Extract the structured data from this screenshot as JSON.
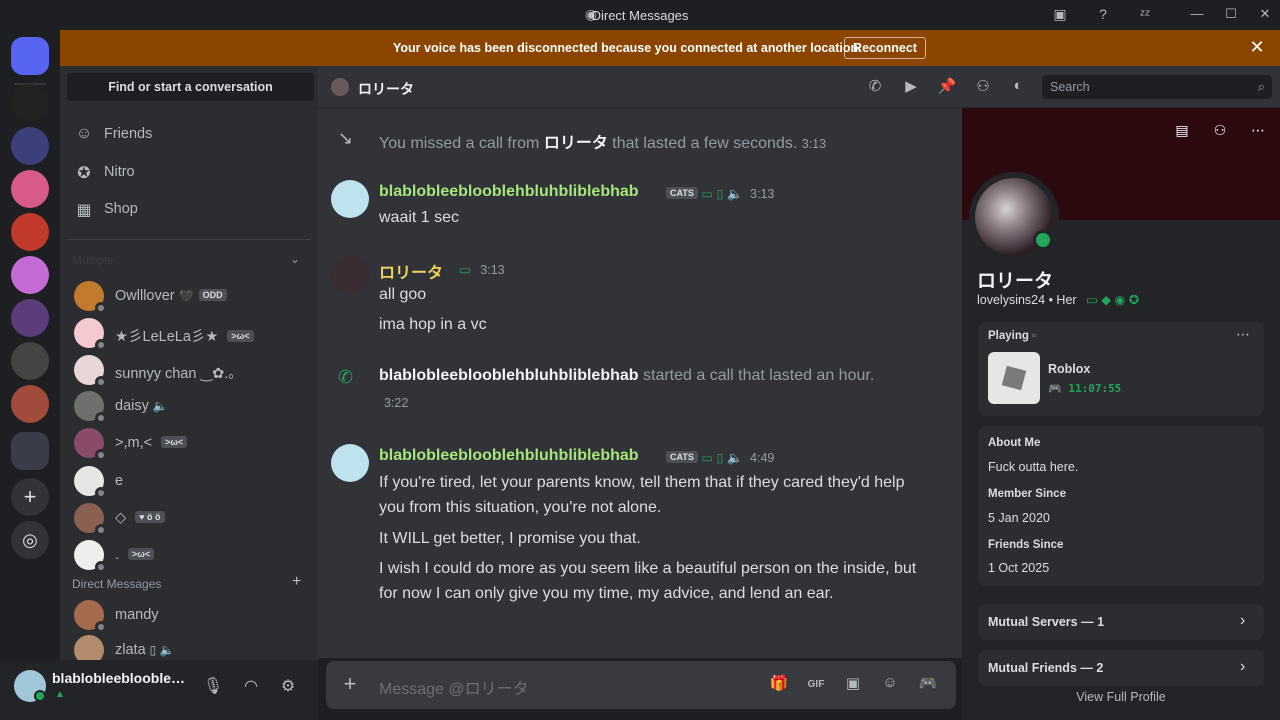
{
  "window": {
    "title": "Direct Messages"
  },
  "notice": {
    "text": "Your voice has been disconnected because you connected at another location.",
    "button": "Reconnect"
  },
  "sidebar": {
    "find_placeholder": "Find or start a conversation",
    "nav": [
      {
        "label": "Friends",
        "icon": "friends-icon"
      },
      {
        "label": "Nitro",
        "icon": "nitro-icon"
      },
      {
        "label": "Shop",
        "icon": "shop-icon"
      }
    ],
    "online_header": "Multiple",
    "friends": [
      {
        "name": "Owlllover",
        "extra": "🖤",
        "tag": "ODD",
        "color": "#c27a2c"
      },
      {
        "name": "★彡LeLeLa彡★",
        "extra": "",
        "tag": ">ω<",
        "color": "#f4c9d0"
      },
      {
        "name": "sunnyy chan ‿✿.｡",
        "extra": "",
        "tag": "",
        "color": "#e8d7d7"
      },
      {
        "name": "daisy",
        "extra": "🔈",
        "tag": "",
        "color": "#6f6f6f"
      },
      {
        "name": ">,m,<",
        "extra": "",
        "tag": ">ω<",
        "color": "#8a4b6a"
      },
      {
        "name": "e",
        "extra": "",
        "tag": "",
        "color": "#e6e6e6"
      },
      {
        "name": "◇",
        "extra": "",
        "tag": "♥ ö ö",
        "color": "#8a6150"
      },
      {
        "name": ".",
        "extra": "",
        "tag": ">ω<",
        "color": "#eeeeee"
      }
    ],
    "dm_header": "Direct Messages",
    "dms": [
      {
        "name": "mandy",
        "color": "#a66a4c"
      },
      {
        "name": "zlata",
        "color": "#b58c6b"
      }
    ]
  },
  "user": {
    "name": "blablobleeblooblehbluhbliblebhab"
  },
  "chat": {
    "recipient": "ロリータ",
    "search_placeholder": "Search",
    "missed_call": {
      "before": "You missed a call from",
      "who": "ロリータ",
      "after": "that lasted a few seconds.",
      "time": "3:13"
    },
    "msg1": {
      "author": "blablobleeblooblehbluhbliblebhab",
      "tag": "CATS",
      "time": "3:13",
      "text": "waait 1 sec"
    },
    "msg2": {
      "author": "ロリータ",
      "time": "3:13",
      "lines": [
        "all goo",
        "ima hop in a vc"
      ]
    },
    "call": {
      "who": "blablobleeblooblehbluhbliblebhab",
      "text": "started a call that lasted an hour.",
      "time": "3:22"
    },
    "msg3": {
      "author": "blablobleeblooblehbluhbliblebhab",
      "tag": "CATS",
      "time": "4:49",
      "lines": [
        "If you're tired, let your parents know, tell them that if they cared they'd help you from this situation, you're not alone.",
        "It WILL get better, I promise you that.",
        "I wish I could do more as you seem like a beautiful person on the inside, but for now I can only give you my time, my advice, and lend an ear."
      ]
    },
    "composer_placeholder": "Message @ロリータ"
  },
  "profile": {
    "name": "ロリータ",
    "username": "lovelysins24",
    "pronouns": "Her",
    "playing_label": "Playing",
    "game": "Roblox",
    "game_time": "11:07:55",
    "about_title": "About Me",
    "about": "Fuck outta here.",
    "member_since_title": "Member Since",
    "member_since": "5 Jan 2020",
    "friends_since_title": "Friends Since",
    "friends_since": "1 Oct 2025",
    "mutual_servers": "Mutual Servers — 1",
    "mutual_friends": "Mutual Friends — 2",
    "view_full": "View Full Profile"
  },
  "colors": {
    "accent_green": "#a6e57a",
    "yellow_name": "#f0d45a",
    "online": "#23a55a",
    "notice_bg": "#8b4500"
  }
}
